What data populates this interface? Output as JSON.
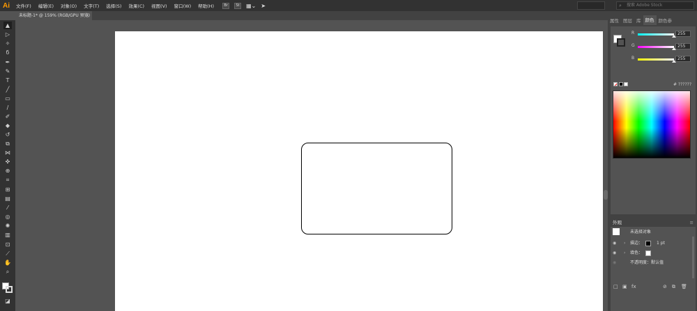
{
  "app": {
    "logo": "Ai"
  },
  "menu": [
    "文件(F)",
    "编辑(E)",
    "对象(O)",
    "文字(T)",
    "选择(S)",
    "效果(C)",
    "视图(V)",
    "窗口(W)",
    "帮助(H)"
  ],
  "menubar_buttons": {
    "bridge": "Br",
    "stock": "St"
  },
  "search": {
    "placeholder": "搜索 Adobe Stock"
  },
  "document_tab": {
    "title": "未标题-1* @ 159% (RGB/GPU 预览)",
    "close": "×"
  },
  "panel_tabs": [
    "属性",
    "图层",
    "库",
    "颜色",
    "颜色参"
  ],
  "color_panel": {
    "sliders": [
      {
        "label": "R",
        "value": "255",
        "color": "#e04848"
      },
      {
        "label": "G",
        "value": "255",
        "color": "#3db83d"
      },
      {
        "label": "B",
        "value": "255",
        "color": "#3a6fd8"
      }
    ],
    "hex_label": "# ??????"
  },
  "appearance": {
    "title": "外观",
    "menu_icon": "≡",
    "no_selection": "未选择对象",
    "stroke_label": "描边：",
    "stroke_value": "1 pt",
    "fill_label": "填色：",
    "opacity_label": "不透明度：默认值"
  },
  "colors": {
    "menubar_bg": "#323232",
    "canvas_bg": "#535353",
    "artboard_bg": "#ffffff",
    "panel_bg": "#424242",
    "accent_logo": "#ff9a00"
  }
}
